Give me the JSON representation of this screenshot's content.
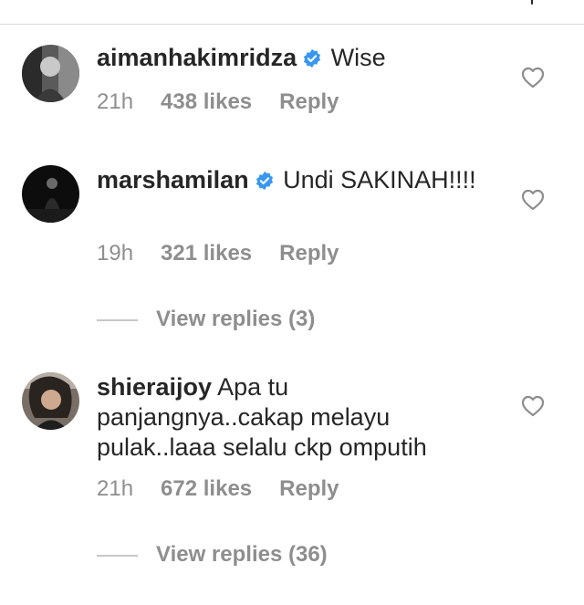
{
  "comments": [
    {
      "username": "aimanhakimridza",
      "verified": true,
      "text": "Wise",
      "time": "21h",
      "likes": "438 likes",
      "reply": "Reply"
    },
    {
      "username": "marshamilan",
      "verified": true,
      "text": "Undi SAKINAH!!!!",
      "time": "19h",
      "likes": "321 likes",
      "reply": "Reply",
      "view_replies": "View replies (3)"
    },
    {
      "username": "shieraijoy",
      "verified": false,
      "text": "Apa tu panjangnya..cakap melayu pulak..laaa selalu ckp omputih",
      "time": "21h",
      "likes": "672 likes",
      "reply": "Reply",
      "view_replies": "View replies (36)"
    }
  ],
  "colors": {
    "text": "#262626",
    "muted": "#8e8e8e",
    "verified": "#3897f0"
  },
  "icons": {
    "like": "heart-outline-icon",
    "verified": "verified-badge-icon"
  }
}
